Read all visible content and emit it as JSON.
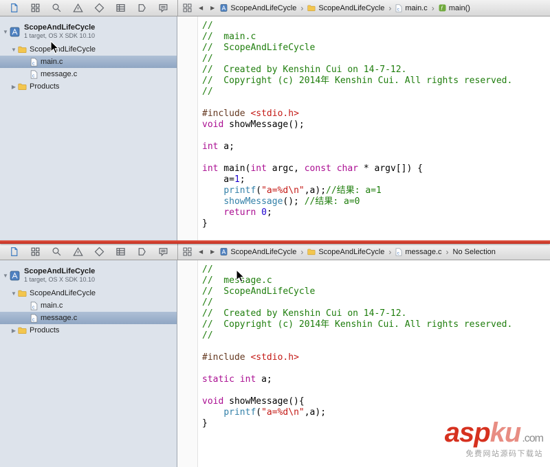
{
  "toolbar": {
    "navigators": [
      "project",
      "symbol",
      "find",
      "issue",
      "test",
      "debug",
      "breakpoint",
      "report"
    ]
  },
  "code_colors": {
    "plain": "#000000",
    "comment": "#1E7D0C",
    "keyword": "#AA0D91",
    "preproc": "#643820",
    "string": "#C41A16",
    "number": "#1C00CF",
    "func": "#3380A8"
  },
  "panes": [
    {
      "jumpbar": {
        "crumb1": "ScopeAndLifeCycle",
        "crumb2": "ScopeAndLifeCycle",
        "crumb3": "main.c",
        "crumb4": "main()"
      },
      "sidebar": {
        "project_name": "ScopeAndLifeCycle",
        "project_subtitle": "1 target, OS X SDK 10.10",
        "group_label": "ScopeAndLifeCycle",
        "file1": "main.c",
        "file2": "message.c",
        "products_label": "Products"
      },
      "code": [
        [
          {
            "t": "//",
            "c": "comment"
          }
        ],
        [
          {
            "t": "//  main.c",
            "c": "comment"
          }
        ],
        [
          {
            "t": "//  ScopeAndLifeCycle",
            "c": "comment"
          }
        ],
        [
          {
            "t": "//",
            "c": "comment"
          }
        ],
        [
          {
            "t": "//  Created by Kenshin Cui on 14-7-12.",
            "c": "comment"
          }
        ],
        [
          {
            "t": "//  Copyright (c) 2014年 Kenshin Cui. All rights reserved.",
            "c": "comment"
          }
        ],
        [
          {
            "t": "//",
            "c": "comment"
          }
        ],
        [],
        [
          {
            "t": "#include",
            "c": "preproc"
          },
          {
            "t": " ",
            "c": "plain"
          },
          {
            "t": "<stdio.h>",
            "c": "string"
          }
        ],
        [
          {
            "t": "void",
            "c": "keyword"
          },
          {
            "t": " showMessage();",
            "c": "plain"
          }
        ],
        [],
        [
          {
            "t": "int",
            "c": "keyword"
          },
          {
            "t": " a;",
            "c": "plain"
          }
        ],
        [],
        [
          {
            "t": "int",
            "c": "keyword"
          },
          {
            "t": " main(",
            "c": "plain"
          },
          {
            "t": "int",
            "c": "keyword"
          },
          {
            "t": " argc, ",
            "c": "plain"
          },
          {
            "t": "const",
            "c": "keyword"
          },
          {
            "t": " ",
            "c": "plain"
          },
          {
            "t": "char",
            "c": "keyword"
          },
          {
            "t": " * argv[]) {",
            "c": "plain"
          }
        ],
        [
          {
            "t": "    a=",
            "c": "plain"
          },
          {
            "t": "1",
            "c": "number"
          },
          {
            "t": ";",
            "c": "plain"
          }
        ],
        [
          {
            "t": "    ",
            "c": "plain"
          },
          {
            "t": "printf",
            "c": "func"
          },
          {
            "t": "(",
            "c": "plain"
          },
          {
            "t": "\"a=%d\\n\"",
            "c": "string"
          },
          {
            "t": ",a);",
            "c": "plain"
          },
          {
            "t": "//结果: a=1",
            "c": "comment"
          }
        ],
        [
          {
            "t": "    ",
            "c": "plain"
          },
          {
            "t": "showMessage",
            "c": "func"
          },
          {
            "t": "(); ",
            "c": "plain"
          },
          {
            "t": "//结果: a=0",
            "c": "comment"
          }
        ],
        [
          {
            "t": "    ",
            "c": "plain"
          },
          {
            "t": "return",
            "c": "keyword"
          },
          {
            "t": " ",
            "c": "plain"
          },
          {
            "t": "0",
            "c": "number"
          },
          {
            "t": ";",
            "c": "plain"
          }
        ],
        [
          {
            "t": "}",
            "c": "plain"
          }
        ]
      ]
    },
    {
      "jumpbar": {
        "crumb1": "ScopeAndLifeCycle",
        "crumb2": "ScopeAndLifeCycle",
        "crumb3": "message.c",
        "crumb4": "No Selection"
      },
      "sidebar": {
        "project_name": "ScopeAndLifeCycle",
        "project_subtitle": "1 target, OS X SDK 10.10",
        "group_label": "ScopeAndLifeCycle",
        "file1": "main.c",
        "file2": "message.c",
        "products_label": "Products"
      },
      "code": [
        [
          {
            "t": "//",
            "c": "comment"
          }
        ],
        [
          {
            "t": "//  message.c",
            "c": "comment"
          }
        ],
        [
          {
            "t": "//  ScopeAndLifeCycle",
            "c": "comment"
          }
        ],
        [
          {
            "t": "//",
            "c": "comment"
          }
        ],
        [
          {
            "t": "//  Created by Kenshin Cui on 14-7-12.",
            "c": "comment"
          }
        ],
        [
          {
            "t": "//  Copyright (c) 2014年 Kenshin Cui. All rights reserved.",
            "c": "comment"
          }
        ],
        [
          {
            "t": "//",
            "c": "comment"
          }
        ],
        [],
        [
          {
            "t": "#include",
            "c": "preproc"
          },
          {
            "t": " ",
            "c": "plain"
          },
          {
            "t": "<stdio.h>",
            "c": "string"
          }
        ],
        [],
        [
          {
            "t": "static",
            "c": "keyword"
          },
          {
            "t": " ",
            "c": "plain"
          },
          {
            "t": "int",
            "c": "keyword"
          },
          {
            "t": " a;",
            "c": "plain"
          }
        ],
        [],
        [
          {
            "t": "void",
            "c": "keyword"
          },
          {
            "t": " showMessage(){",
            "c": "plain"
          }
        ],
        [
          {
            "t": "    ",
            "c": "plain"
          },
          {
            "t": "printf",
            "c": "func"
          },
          {
            "t": "(",
            "c": "plain"
          },
          {
            "t": "\"a=%d\\n\"",
            "c": "string"
          },
          {
            "t": ",a);",
            "c": "plain"
          }
        ],
        [
          {
            "t": "}",
            "c": "plain"
          }
        ]
      ]
    }
  ],
  "watermark": {
    "brand_red": "asp",
    "brand_gray": "ku",
    "domain": ".com",
    "subtitle": "免费网站源码下载站"
  }
}
